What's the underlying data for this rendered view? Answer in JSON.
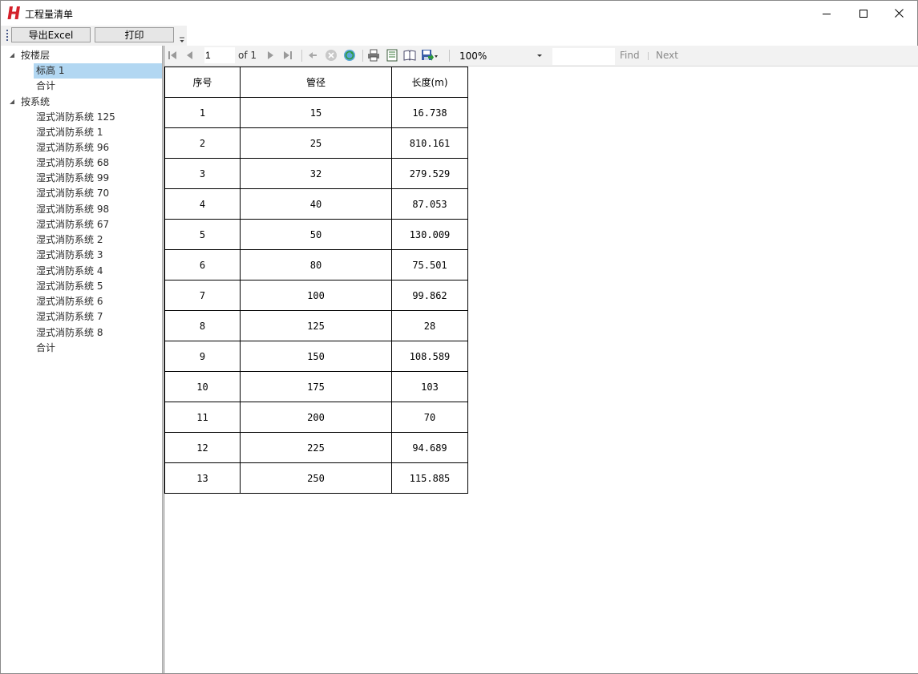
{
  "window": {
    "title": "工程量清单"
  },
  "toolbar": {
    "export_label": "导出Excel",
    "print_label": "打印"
  },
  "tree": {
    "groups": [
      {
        "label": "按楼层",
        "children": [
          "标高 1",
          "合计"
        ]
      },
      {
        "label": "按系统",
        "children": [
          "湿式消防系统 125",
          "湿式消防系统 1",
          "湿式消防系统 96",
          "湿式消防系统 68",
          "湿式消防系统 99",
          "湿式消防系统 70",
          "湿式消防系统 98",
          "湿式消防系统 67",
          "湿式消防系统 2",
          "湿式消防系统 3",
          "湿式消防系统 4",
          "湿式消防系统 5",
          "湿式消防系统 6",
          "湿式消防系统 7",
          "湿式消防系统 8",
          "合计"
        ]
      }
    ],
    "selected": "标高 1"
  },
  "viewer": {
    "page_current": "1",
    "page_of_label": "of 1",
    "zoom": "100%",
    "find_label": "Find",
    "next_label": "Next",
    "icons": [
      "first-page-icon",
      "previous-page-icon",
      "next-page-icon",
      "last-page-icon",
      "back-icon",
      "stop-icon",
      "refresh-icon",
      "print-icon",
      "print-layout-icon",
      "page-setup-icon",
      "export-icon"
    ]
  },
  "table": {
    "headers": [
      "序号",
      "管径",
      "长度(m)"
    ],
    "rows": [
      [
        "1",
        "15",
        "16.738"
      ],
      [
        "2",
        "25",
        "810.161"
      ],
      [
        "3",
        "32",
        "279.529"
      ],
      [
        "4",
        "40",
        "87.053"
      ],
      [
        "5",
        "50",
        "130.009"
      ],
      [
        "6",
        "80",
        "75.501"
      ],
      [
        "7",
        "100",
        "99.862"
      ],
      [
        "8",
        "125",
        "28"
      ],
      [
        "9",
        "150",
        "108.589"
      ],
      [
        "10",
        "175",
        "103"
      ],
      [
        "11",
        "200",
        "70"
      ],
      [
        "12",
        "225",
        "94.689"
      ],
      [
        "13",
        "250",
        "115.885"
      ]
    ]
  },
  "colors": {
    "selection": "#b2d7f2",
    "logo": "#d4202a",
    "toolbar": "#f0f0f0"
  }
}
